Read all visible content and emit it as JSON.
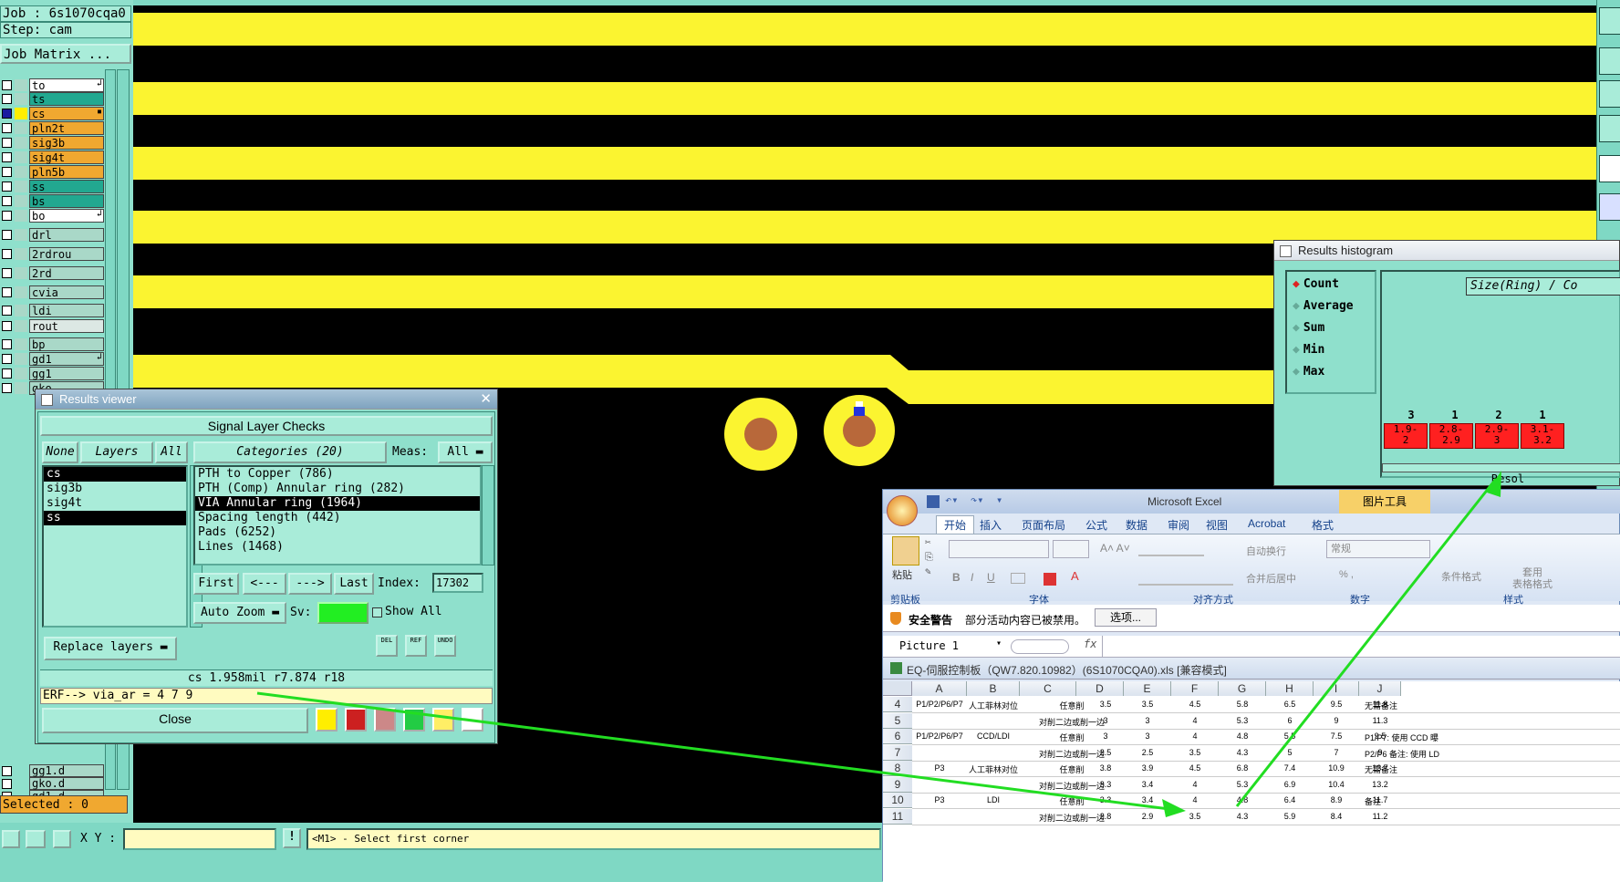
{
  "job_label": "Job : 6s1070cqa0",
  "step_label": "Step: cam",
  "job_matrix_btn": "Job Matrix ...",
  "layers": [
    {
      "name": "to",
      "color": "#ffffff",
      "checked": false,
      "mark": "↲"
    },
    {
      "name": "ts",
      "color": "#22a890",
      "checked": false,
      "mark": ""
    },
    {
      "name": "cs",
      "color": "#f0a830",
      "checked": true,
      "mark": "▪"
    },
    {
      "name": "pln2t",
      "color": "#f0a830",
      "checked": false,
      "mark": ""
    },
    {
      "name": "sig3b",
      "color": "#f0a830",
      "checked": false,
      "mark": ""
    },
    {
      "name": "sig4t",
      "color": "#f0a830",
      "checked": false,
      "mark": ""
    },
    {
      "name": "pln5b",
      "color": "#f0a830",
      "checked": false,
      "mark": ""
    },
    {
      "name": "ss",
      "color": "#22a890",
      "checked": false,
      "mark": ""
    },
    {
      "name": "bs",
      "color": "#22a890",
      "checked": false,
      "mark": ""
    },
    {
      "name": "bo",
      "color": "#ffffff",
      "checked": false,
      "mark": "↲"
    },
    {
      "name": "drl",
      "color": "#a9d8c8",
      "checked": false,
      "mark": ""
    },
    {
      "name": "2rdrou",
      "color": "#a9d8c8",
      "checked": false,
      "mark": ""
    },
    {
      "name": "2rd",
      "color": "#a9d8c8",
      "checked": false,
      "mark": ""
    },
    {
      "name": "cvia",
      "color": "#a9d8c8",
      "checked": false,
      "mark": ""
    },
    {
      "name": "ldi",
      "color": "#a9d8c8",
      "checked": false,
      "mark": ""
    },
    {
      "name": "rout",
      "color": "#dce8e4",
      "checked": false,
      "mark": ""
    },
    {
      "name": "bp",
      "color": "#a9d8c8",
      "checked": false,
      "mark": ""
    },
    {
      "name": "gd1",
      "color": "#a9d8c8",
      "checked": false,
      "mark": "↲"
    },
    {
      "name": "gg1",
      "color": "#a9d8c8",
      "checked": false,
      "mark": ""
    },
    {
      "name": "gko",
      "color": "#a9d8c8",
      "checked": false,
      "mark": ""
    }
  ],
  "layers_bottom": [
    {
      "name": "gg1.d",
      "color": "#a9d8c8"
    },
    {
      "name": "gko.d",
      "color": "#a9d8c8"
    },
    {
      "name": "gd1.d",
      "color": "#a9d8c8"
    }
  ],
  "selected_label": "Selected : 0",
  "xy_label": "X Y :",
  "xy_value": "",
  "status_msg": "<M1> - Select first corner",
  "results_viewer": {
    "title": "Results viewer",
    "header": "Signal Layer Checks",
    "none_btn": "None",
    "layers_btn": "Layers",
    "all_btn": "All",
    "categories_btn": "Categories (20)",
    "meas_label": "Meas:",
    "meas_value": "All",
    "layer_list": [
      {
        "name": "cs",
        "sel": true
      },
      {
        "name": "sig3b",
        "sel": false
      },
      {
        "name": "sig4t",
        "sel": false
      },
      {
        "name": "ss",
        "sel": true
      }
    ],
    "category_list": [
      {
        "name": "PTH to Copper (786)",
        "sel": false
      },
      {
        "name": "PTH (Comp) Annular ring (282)",
        "sel": false
      },
      {
        "name": "VIA Annular ring (1964)",
        "sel": true
      },
      {
        "name": "Spacing length (442)",
        "sel": false
      },
      {
        "name": "Pads (6252)",
        "sel": false
      },
      {
        "name": "Lines (1468)",
        "sel": false
      }
    ],
    "first_btn": "First",
    "prev_btn": "<---",
    "next_btn": "--->",
    "last_btn": "Last",
    "index_label": "Index:",
    "index_value": "17302",
    "autozoom_btn": "Auto Zoom",
    "sv_label": "Sv:",
    "show_all_label": "Show All",
    "replace_btn": "Replace layers",
    "del_btn": "DEL",
    "ref_btn": "REF",
    "undo_btn": "UNDO",
    "measure_text": "cs 1.958mil  r7.874  r18",
    "erf_text": "ERF--> via_ar = 4 7 9",
    "close_btn": "Close"
  },
  "histogram": {
    "title": "Results histogram",
    "options": [
      "Count",
      "Average",
      "Sum",
      "Min",
      "Max"
    ],
    "selected_option": "Count",
    "axis_title": "Size(Ring) / Co",
    "counts": [
      "3",
      "1",
      "2",
      "1"
    ],
    "bins": [
      "1.9-\n2",
      "2.8-\n2.9",
      "2.9-\n3",
      "3.1-\n3.2"
    ],
    "resol_label": "Resol"
  },
  "excel": {
    "app_title": "Microsoft Excel",
    "pic_tools": "图片工具",
    "tabs": [
      "开始",
      "插入",
      "页面布局",
      "公式",
      "数据",
      "审阅",
      "视图",
      "Acrobat",
      "格式"
    ],
    "groups": [
      "剪贴板",
      "字体",
      "对齐方式",
      "数字",
      "样式"
    ],
    "paste": "粘贴",
    "wrap": "自动换行",
    "merge": "合并后居中",
    "numfmt": "常规",
    "cond_fmt": "条件格式",
    "table_fmt": "套用\n表格格式",
    "security_label": "安全警告",
    "security_msg": "部分活动内容已被禁用。",
    "options_btn": "选项...",
    "namebox": "Picture 1",
    "fx": "fx",
    "file_title": "EQ-伺服控制板（QW7.820.10982）(6S1070CQA0).xls  [兼容模式]",
    "columns": [
      "A",
      "B",
      "C",
      "D",
      "E",
      "F",
      "G",
      "H",
      "I",
      "J"
    ],
    "rows": [
      {
        "n": "4",
        "a": "P1/P2/P6/P7",
        "b": "人工菲林对位",
        "c": "任意削",
        "vals": [
          "3.5",
          "3.5",
          "4.5",
          "5.8",
          "6.5",
          "9.5",
          "11.8"
        ],
        "j": "无需备注"
      },
      {
        "n": "5",
        "a": "",
        "b": "",
        "c": "对削二边或削一边",
        "vals": [
          "3",
          "3",
          "4",
          "5.3",
          "6",
          "9",
          "11.3"
        ],
        "j": ""
      },
      {
        "n": "6",
        "a": "P1/P2/P6/P7",
        "b": "CCD/LDI",
        "c": "任意削",
        "vals": [
          "3",
          "3",
          "4",
          "4.8",
          "5.5",
          "7.5",
          "9.5"
        ],
        "j": "P1/P7: 使用 CCD 曝"
      },
      {
        "n": "7",
        "a": "",
        "b": "",
        "c": "对削二边或削一边",
        "vals": [
          "2.5",
          "2.5",
          "3.5",
          "4.3",
          "5",
          "7",
          "9"
        ],
        "j": "P2/P6 备注: 使用 LD"
      },
      {
        "n": "8",
        "a": "P3",
        "b": "人工菲林对位",
        "c": "任意削",
        "vals": [
          "3.8",
          "3.9",
          "4.5",
          "6.8",
          "7.4",
          "10.9",
          "13.7"
        ],
        "j": "无需备注"
      },
      {
        "n": "9",
        "a": "",
        "b": "",
        "c": "对削二边或削一边",
        "vals": [
          "3.3",
          "3.4",
          "4",
          "5.3",
          "6.9",
          "10.4",
          "13.2"
        ],
        "j": ""
      },
      {
        "n": "10",
        "a": "P3",
        "b": "LDI",
        "c": "任意削",
        "vals": [
          "3.3",
          "3.4",
          "4",
          "4.8",
          "6.4",
          "8.9",
          "11.7"
        ],
        "j": "备注"
      },
      {
        "n": "11",
        "a": "",
        "b": "",
        "c": "对削二边或削一边",
        "vals": [
          "2.8",
          "2.9",
          "3.5",
          "4.3",
          "5.9",
          "8.4",
          "11.2"
        ],
        "j": ""
      }
    ]
  },
  "colors": {
    "teal": "#7fd8c4",
    "yellow": "#fbf430",
    "pad": "#b8683a",
    "arrow": "#22dd22",
    "hist_red": "#ff2020"
  }
}
